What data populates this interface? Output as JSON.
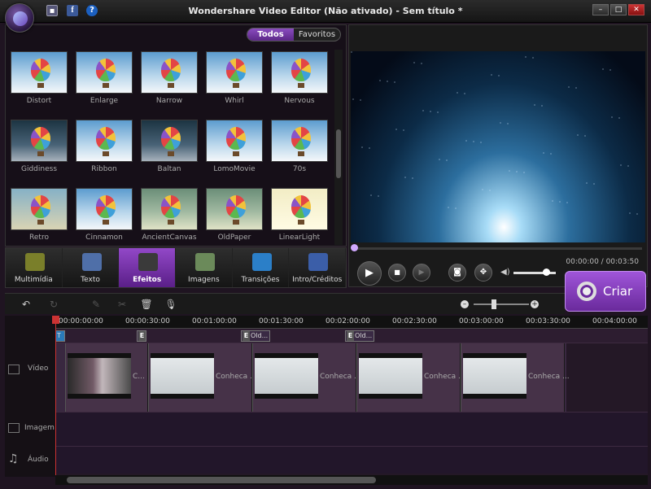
{
  "window": {
    "title": "Wondershare Video Editor (Não ativado) - Sem título *",
    "controls": [
      "–",
      "□",
      "✕"
    ]
  },
  "filters": {
    "all": "Todos",
    "favorites": "Favoritos"
  },
  "effects": [
    {
      "label": "Distort",
      "style": "normal"
    },
    {
      "label": "Enlarge",
      "style": "normal"
    },
    {
      "label": "Narrow",
      "style": "normal"
    },
    {
      "label": "Whirl",
      "style": "normal"
    },
    {
      "label": "Nervous",
      "style": "normal"
    },
    {
      "label": "Giddiness",
      "style": "dark"
    },
    {
      "label": "Ribbon",
      "style": "normal"
    },
    {
      "label": "Baltan",
      "style": "dark"
    },
    {
      "label": "LomoMovie",
      "style": "normal"
    },
    {
      "label": "70s",
      "style": "normal"
    },
    {
      "label": "Retro",
      "style": "retro"
    },
    {
      "label": "Cinnamon",
      "style": "normal"
    },
    {
      "label": "AncientCanvas",
      "style": "warm"
    },
    {
      "label": "OldPaper",
      "style": "warm"
    },
    {
      "label": "LinearLight",
      "style": "light"
    }
  ],
  "categories": [
    {
      "label": "Multimídia",
      "color": "#7a7f2a"
    },
    {
      "label": "Texto",
      "color": "#4f6fa8"
    },
    {
      "label": "Efeitos",
      "color": "#3a3a3a"
    },
    {
      "label": "Imagens",
      "color": "#6b8a5a"
    },
    {
      "label": "Transições",
      "color": "#2b7fc8"
    },
    {
      "label": "Intro/Créditos",
      "color": "#3b5ea8"
    }
  ],
  "active_category": "Efeitos",
  "preview": {
    "time": "00:00:00 / 00:03:50",
    "progress": 0,
    "volume": 0.8
  },
  "create_button": "Criar",
  "ruler": [
    "00:00:00:00",
    "00:00:30:00",
    "00:01:00:00",
    "00:01:30:00",
    "00:02:00:00",
    "00:02:30:00",
    "00:03:00:00",
    "00:03:30:00",
    "00:04:00:00"
  ],
  "tracks": {
    "video": "Vídeo",
    "image": "Imagem",
    "audio": "Áudio"
  },
  "text_markers": {
    "first": "T",
    "e": "E",
    "old": "Old..."
  },
  "clips": [
    {
      "label": "C...",
      "type": "video"
    },
    {
      "label": "Conheca ...",
      "type": "slide"
    },
    {
      "label": "Conheca ...",
      "type": "slide"
    },
    {
      "label": "Conheca ...",
      "type": "slide"
    },
    {
      "label": "Conheca ...",
      "type": "slide"
    }
  ],
  "accent": "#8a4cc0"
}
